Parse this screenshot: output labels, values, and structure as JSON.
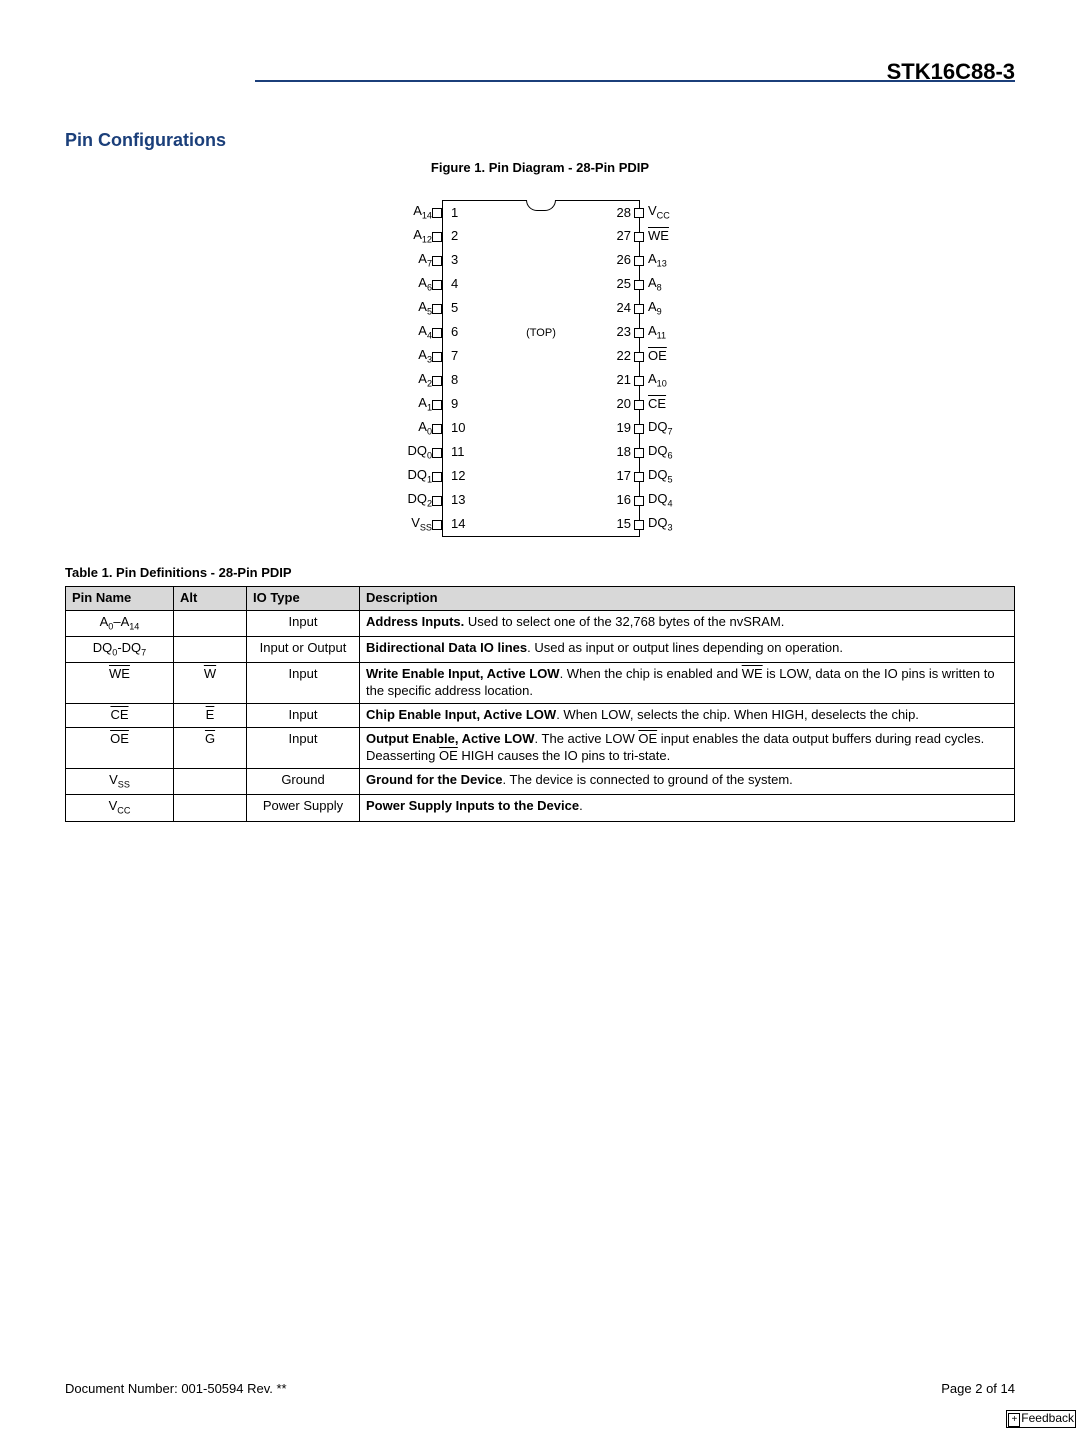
{
  "header": {
    "part_number": "STK16C88-3"
  },
  "section_title": "Pin Configurations",
  "figure_caption": "Figure 1.  Pin Diagram - 28-Pin PDIP",
  "chip": {
    "center_label": "(TOP)",
    "left_pins": [
      {
        "label": "A",
        "sub": "14",
        "num": "1"
      },
      {
        "label": "A",
        "sub": "12",
        "num": "2"
      },
      {
        "label": "A",
        "sub": "7",
        "num": "3"
      },
      {
        "label": "A",
        "sub": "6",
        "num": "4"
      },
      {
        "label": "A",
        "sub": "5",
        "num": "5"
      },
      {
        "label": "A",
        "sub": "4",
        "num": "6"
      },
      {
        "label": "A",
        "sub": "3",
        "num": "7"
      },
      {
        "label": "A",
        "sub": "2",
        "num": "8"
      },
      {
        "label": "A",
        "sub": "1",
        "num": "9"
      },
      {
        "label": "A",
        "sub": "0",
        "num": "10"
      },
      {
        "label": "DQ",
        "sub": "0",
        "num": "11"
      },
      {
        "label": "DQ",
        "sub": "1",
        "num": "12"
      },
      {
        "label": "DQ",
        "sub": "2",
        "num": "13"
      },
      {
        "label": "V",
        "sub": "SS",
        "num": "14"
      }
    ],
    "right_pins": [
      {
        "num": "28",
        "label": "V",
        "sub": "CC",
        "ov": false
      },
      {
        "num": "27",
        "label": "WE",
        "sub": "",
        "ov": true
      },
      {
        "num": "26",
        "label": "A",
        "sub": "13",
        "ov": false
      },
      {
        "num": "25",
        "label": "A",
        "sub": "8",
        "ov": false
      },
      {
        "num": "24",
        "label": "A",
        "sub": "9",
        "ov": false
      },
      {
        "num": "23",
        "label": "A",
        "sub": "11",
        "ov": false
      },
      {
        "num": "22",
        "label": "OE",
        "sub": "",
        "ov": true
      },
      {
        "num": "21",
        "label": "A",
        "sub": "10",
        "ov": false
      },
      {
        "num": "20",
        "label": "CE",
        "sub": "",
        "ov": true
      },
      {
        "num": "19",
        "label": "DQ",
        "sub": "7",
        "ov": false
      },
      {
        "num": "18",
        "label": "DQ",
        "sub": "6",
        "ov": false
      },
      {
        "num": "17",
        "label": "DQ",
        "sub": "5",
        "ov": false
      },
      {
        "num": "16",
        "label": "DQ",
        "sub": "4",
        "ov": false
      },
      {
        "num": "15",
        "label": "DQ",
        "sub": "3",
        "ov": false
      }
    ]
  },
  "table_caption": "Table 1.  Pin Definitions - 28-Pin PDIP",
  "table": {
    "headers": [
      "Pin Name",
      "Alt",
      "IO Type",
      "Description"
    ],
    "rows": [
      {
        "name_html": "A<sub>0</sub>–A<sub>14</sub>",
        "alt": "",
        "io": "Input",
        "desc_html": "<b>Address Inputs.</b> Used to select one of the 32,768 bytes of the nvSRAM."
      },
      {
        "name_html": "DQ<sub>0</sub>-DQ<sub>7</sub>",
        "alt": "",
        "io": "Input or Output",
        "desc_html": "<b>Bidirectional Data IO lines</b>. Used as input or output lines depending on operation."
      },
      {
        "name_html": "<span class='ov'>WE</span>",
        "alt_html": "<span class='ov'>W</span>",
        "io": "Input",
        "desc_html": "<b>Write Enable Input, Active LOW</b>. When the chip is enabled and <span class='ov'>WE</span> is LOW, data on the IO pins is written to the specific address location."
      },
      {
        "name_html": "<span class='ov'>CE</span>",
        "alt_html": "<span class='ov'>E</span>",
        "io": "Input",
        "desc_html": "<b>Chip Enable Input, Active LOW</b>. When LOW, selects the chip. When HIGH, deselects the chip."
      },
      {
        "name_html": "<span class='ov'>OE</span>",
        "alt_html": "<span class='ov'>G</span>",
        "io": "Input",
        "desc_html": "<b>Output Enable, Active LOW</b>. The active LOW <span class='ov'>OE</span> input enables the data output buffers during read cycles. Deasserting <span class='ov'>OE</span> HIGH causes the IO pins to tri-state."
      },
      {
        "name_html": "V<sub>SS</sub>",
        "alt": "",
        "io": "Ground",
        "desc_html": "<b>Ground for the Device</b>. The device is connected to ground of the system."
      },
      {
        "name_html": "V<sub>CC</sub>",
        "alt": "",
        "io": "Power Supply",
        "desc_html": "<b>Power Supply Inputs to the Device</b>."
      }
    ]
  },
  "footer": {
    "doc": "Document Number: 001-50594 Rev. **",
    "page": "Page 2 of 14"
  },
  "feedback": {
    "label": "Feedback",
    "plus": "+"
  }
}
